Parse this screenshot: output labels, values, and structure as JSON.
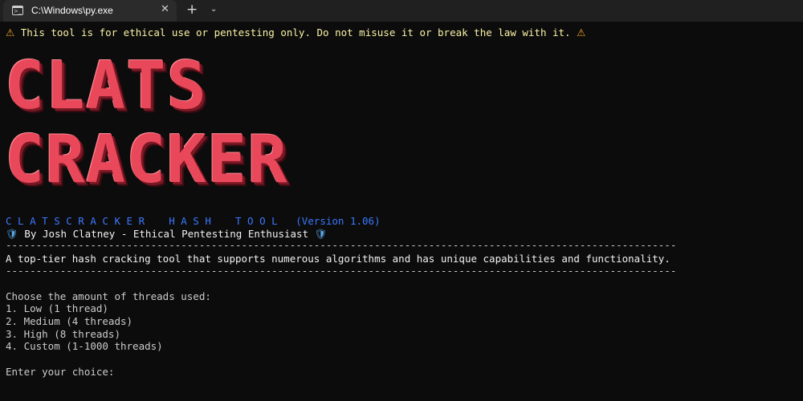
{
  "window": {
    "tab_title": "C:\\Windows\\py.exe",
    "close_glyph": "✕",
    "new_tab_glyph": "+",
    "dropdown_glyph": "⌄"
  },
  "terminal": {
    "warning_icon": "⚠",
    "warning_text": "This tool is for ethical use or pentesting only. Do not misuse it or break the law with it.",
    "banner_line1": "CLATS",
    "banner_line2": "CRACKER",
    "subtitle": "C L A T S C R A C K E R    H A S H    T O O L   (Version 1.06)",
    "shield_icon": "🛡",
    "author": "By Josh Clatney - Ethical Pentesting Enthusiast",
    "separator": "---------------------------------------------------------------------------------------------------------------",
    "description": "A top-tier hash cracking tool that supports numerous algorithms and has unique capabilities and functionality.",
    "menu_heading": "Choose the amount of threads used:",
    "options": [
      "1. Low (1 thread)",
      "2. Medium (4 threads)",
      "3. High (8 threads)",
      "4. Custom (1-1000 threads)"
    ],
    "prompt": "Enter your choice:"
  },
  "colors": {
    "background": "#0c0c0c",
    "warning_text": "#f9f1a5",
    "banner": "#e8485a",
    "subtitle": "#3b78ff",
    "text": "#f2f2f2"
  }
}
